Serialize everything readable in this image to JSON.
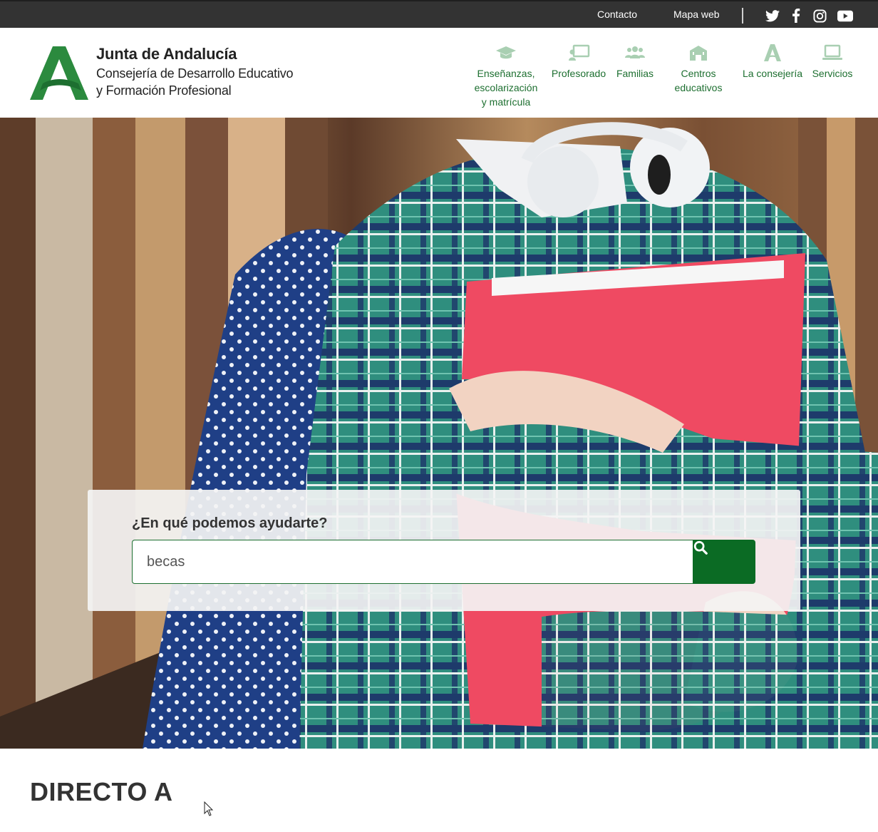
{
  "topbar": {
    "links": [
      "Contacto",
      "Mapa web"
    ],
    "social_icons": [
      "twitter-icon",
      "facebook-icon",
      "instagram-icon",
      "youtube-icon"
    ]
  },
  "logo": {
    "title": "Junta de Andalucía",
    "subtitle_line1": "Consejería de Desarrollo Educativo",
    "subtitle_line2": "y Formación Profesional"
  },
  "nav": {
    "items": [
      {
        "label": "Enseñanzas,\nescolarización\ny matrícula",
        "icon": "graduation-cap-icon"
      },
      {
        "label": "Profesorado",
        "icon": "teacher-board-icon"
      },
      {
        "label": "Familias",
        "icon": "users-icon"
      },
      {
        "label": "Centros\neducativos",
        "icon": "school-building-icon"
      },
      {
        "label": "La consejería",
        "icon": "andalucia-a-icon"
      },
      {
        "label": "Servicios",
        "icon": "laptop-icon"
      }
    ]
  },
  "search": {
    "question": "¿En qué podemos ayudarte?",
    "value": "becas"
  },
  "section": {
    "title": "DIRECTO A"
  },
  "colors": {
    "brand_green": "#1d6f30",
    "button_green": "#0b6b24",
    "nav_icon": "#a9cfb2",
    "topbar": "#333333"
  }
}
